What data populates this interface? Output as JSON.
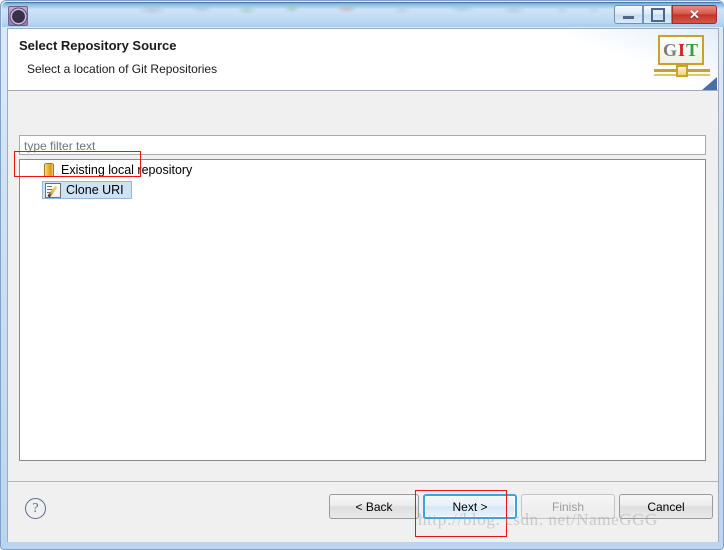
{
  "window": {
    "icon_name": "eclipse-gear-icon",
    "controls": {
      "minimize_label": "—",
      "maximize_label": "□",
      "close_label": "✕"
    }
  },
  "header": {
    "title": "Select Repository Source",
    "subtitle": "Select a location of Git Repositories",
    "logo": {
      "g": "G",
      "i": "I",
      "t": "T"
    }
  },
  "filter": {
    "value": "",
    "placeholder": "type filter text"
  },
  "tree": {
    "items": [
      {
        "label": "Existing local repository",
        "icon": "repository-icon",
        "selected": false
      },
      {
        "label": "Clone URI",
        "icon": "clone-uri-icon",
        "selected": true
      }
    ]
  },
  "footer": {
    "help_label": "?",
    "buttons": {
      "back": "< Back",
      "next": "Next >",
      "finish": "Finish",
      "cancel": "Cancel"
    }
  },
  "annotations": {
    "watermark": "http://blog. csdn. net/NameGGG",
    "highlight_color": "#ee1111"
  }
}
